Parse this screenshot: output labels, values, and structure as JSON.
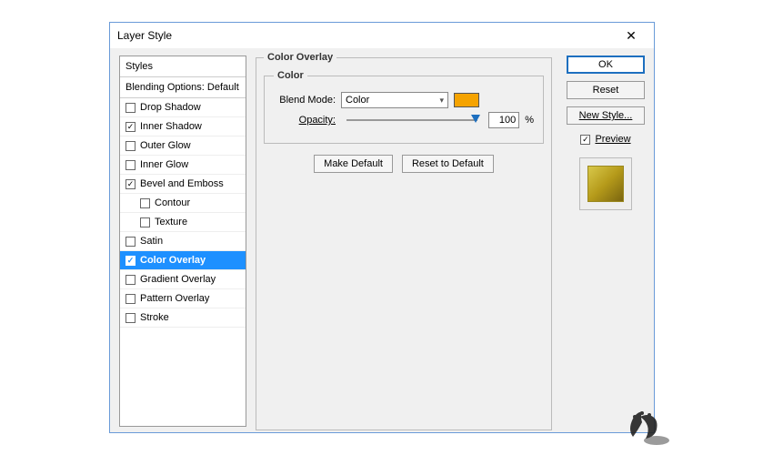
{
  "dialog": {
    "title": "Layer Style"
  },
  "styles": {
    "header": "Styles",
    "blending": "Blending Options: Default",
    "items": [
      {
        "label": "Drop Shadow",
        "checked": false,
        "indent": false,
        "selected": false
      },
      {
        "label": "Inner Shadow",
        "checked": true,
        "indent": false,
        "selected": false
      },
      {
        "label": "Outer Glow",
        "checked": false,
        "indent": false,
        "selected": false
      },
      {
        "label": "Inner Glow",
        "checked": false,
        "indent": false,
        "selected": false
      },
      {
        "label": "Bevel and Emboss",
        "checked": true,
        "indent": false,
        "selected": false
      },
      {
        "label": "Contour",
        "checked": false,
        "indent": true,
        "selected": false
      },
      {
        "label": "Texture",
        "checked": false,
        "indent": true,
        "selected": false
      },
      {
        "label": "Satin",
        "checked": false,
        "indent": false,
        "selected": false
      },
      {
        "label": "Color Overlay",
        "checked": true,
        "indent": false,
        "selected": true
      },
      {
        "label": "Gradient Overlay",
        "checked": false,
        "indent": false,
        "selected": false
      },
      {
        "label": "Pattern Overlay",
        "checked": false,
        "indent": false,
        "selected": false
      },
      {
        "label": "Stroke",
        "checked": false,
        "indent": false,
        "selected": false
      }
    ]
  },
  "overlay": {
    "group_title": "Color Overlay",
    "color_group": "Color",
    "blend_mode_label": "Blend Mode:",
    "blend_mode_value": "Color",
    "swatch_color": "#f5a300",
    "opacity_label": "Opacity:",
    "opacity_value": "100",
    "opacity_unit": "%",
    "make_default": "Make Default",
    "reset_default": "Reset to Default"
  },
  "buttons": {
    "ok": "OK",
    "reset": "Reset",
    "new_style": "New Style...",
    "preview": "Preview",
    "preview_checked": true
  }
}
